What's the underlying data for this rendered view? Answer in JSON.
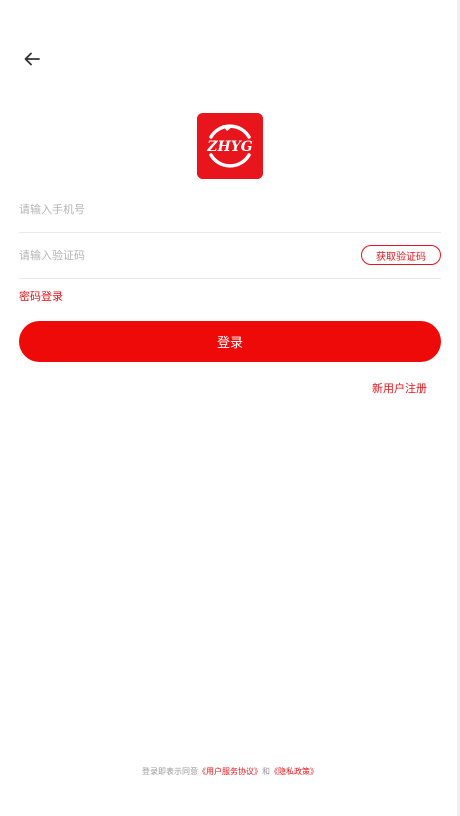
{
  "header": {
    "back_icon": "arrow-left-icon"
  },
  "logo": {
    "text": "ZHYG",
    "color": "#e8151c"
  },
  "form": {
    "phone_placeholder": "请输入手机号",
    "code_placeholder": "请输入验证码",
    "get_code_label": "获取验证码",
    "password_login_label": "密码登录",
    "login_label": "登录",
    "register_label": "新用户注册"
  },
  "footer": {
    "prefix": "登录即表示同意",
    "user_agreement": "《用户服务协议》",
    "and": "和",
    "privacy_policy": "《隐私政策》"
  },
  "colors": {
    "accent": "#e8151c",
    "button": "#ef0a0a"
  }
}
